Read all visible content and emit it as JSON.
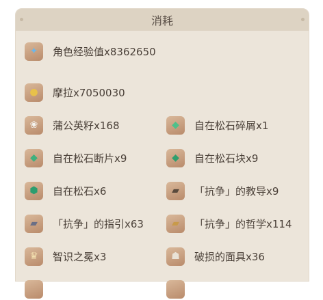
{
  "header": {
    "title": "消耗"
  },
  "items": [
    {
      "label": "角色经验值x8362650",
      "icon": "exp-book-icon",
      "glyph": "✦",
      "glyph_color": "#6fb6e6"
    },
    {
      "label": "摩拉x7050030",
      "icon": "mora-coin-icon",
      "glyph": "●",
      "glyph_color": "#e8c14a"
    },
    {
      "label": "蒲公英籽x168",
      "icon": "dandelion-seed-icon",
      "glyph": "❀",
      "glyph_color": "#f4f4f0"
    },
    {
      "label": "自在松石碎屑x1",
      "icon": "turquoise-sliver-icon",
      "glyph": "◆",
      "glyph_color": "#4fc08a"
    },
    {
      "label": "自在松石断片x9",
      "icon": "turquoise-fragment-icon",
      "glyph": "◆",
      "glyph_color": "#3fb07e"
    },
    {
      "label": "自在松石块x9",
      "icon": "turquoise-chunk-icon",
      "glyph": "◆",
      "glyph_color": "#2f9f6e"
    },
    {
      "label": "自在松石x6",
      "icon": "turquoise-gemstone-icon",
      "glyph": "⬢",
      "glyph_color": "#2c9d6f"
    },
    {
      "label": "「抗争」的教导x9",
      "icon": "teachings-book-icon",
      "glyph": "▰",
      "glyph_color": "#5a4a3c"
    },
    {
      "label": "「抗争」的指引x63",
      "icon": "guide-book-icon",
      "glyph": "▰",
      "glyph_color": "#6a6f86"
    },
    {
      "label": "「抗争」的哲学x114",
      "icon": "philosophies-book-icon",
      "glyph": "▰",
      "glyph_color": "#c89a4a"
    },
    {
      "label": "智识之冕x3",
      "icon": "crown-icon",
      "glyph": "♛",
      "glyph_color": "#f3e1b0"
    },
    {
      "label": "破损的面具x36",
      "icon": "damaged-mask-icon",
      "glyph": "☗",
      "glyph_color": "#e9e2d6"
    }
  ]
}
